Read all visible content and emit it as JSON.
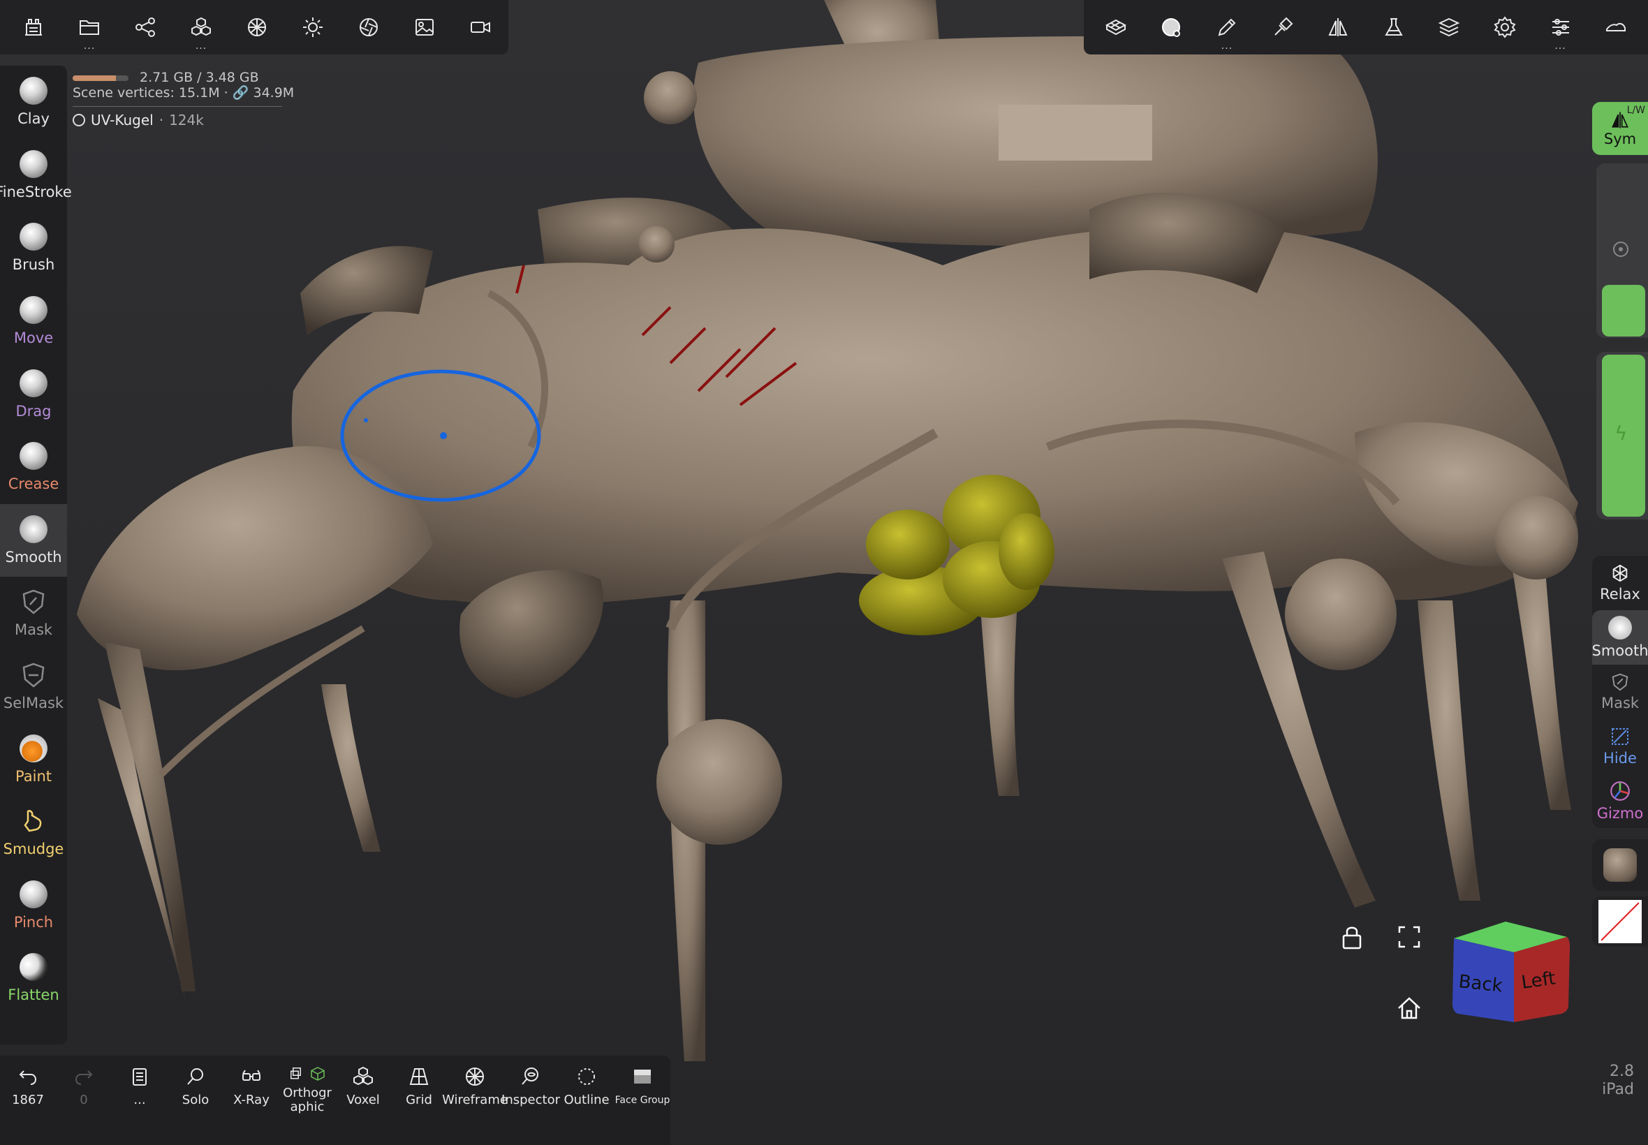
{
  "stats": {
    "memory": "2.71 GB / 3.48 GB",
    "memory_fraction": 0.78,
    "scene_vertices_label": "Scene vertices:",
    "scene_vertices_value": "15.1M",
    "linked_value": "34.9M",
    "object_name": "UV-Kugel",
    "object_count": "124k"
  },
  "top_left_tools": [
    "scene-icon",
    "open-file-icon",
    "share-icon",
    "objects-icon",
    "material-icon",
    "light-icon",
    "camera-aperture-icon",
    "image-icon",
    "video-icon"
  ],
  "top_right_tools": [
    "topology-icon",
    "active-brush-icon",
    "stroke-pen-icon",
    "brush-settings-icon",
    "symmetry-icon",
    "flask-icon",
    "layers-icon",
    "settings-gear-icon",
    "sliders-icon",
    "interface-icon"
  ],
  "left_tools": [
    {
      "label": "Clay",
      "color": "#e6e6e6"
    },
    {
      "label": "FineStroke",
      "color": "#e6e6e6"
    },
    {
      "label": "Brush",
      "color": "#e6e6e6"
    },
    {
      "label": "Move",
      "color": "#b48cd8"
    },
    {
      "label": "Drag",
      "color": "#b48cd8"
    },
    {
      "label": "Crease",
      "color": "#e98a6c"
    },
    {
      "label": "Smooth",
      "color": "#e6e6e6"
    },
    {
      "label": "Mask",
      "color": "#9a9a9a"
    },
    {
      "label": "SelMask",
      "color": "#9a9a9a"
    },
    {
      "label": "Paint",
      "color": "#f0c070"
    },
    {
      "label": "Smudge",
      "color": "#f0d070"
    },
    {
      "label": "Pinch",
      "color": "#e98a6c"
    },
    {
      "label": "Flatten",
      "color": "#8ad86a"
    }
  ],
  "right": {
    "sym_label": "Sym",
    "sym_lw": "L/W",
    "relax_label": "Relax",
    "smooth_label": "Smooth",
    "mask_label": "Mask",
    "hide_label": "Hide",
    "gizmo_label": "Gizmo",
    "radius_fraction": 0.3,
    "intensity_fraction": 1.0
  },
  "bottom": {
    "undo_count": "1867",
    "redo_count": "0",
    "more": "...",
    "solo": "Solo",
    "xray": "X-Ray",
    "ortho": "Orthographic",
    "voxel": "Voxel",
    "grid": "Grid",
    "wireframe": "Wireframe",
    "inspector": "Inspector",
    "outline": "Outline",
    "facegroup": "Face Group"
  },
  "cube": {
    "back": "Back",
    "left": "Left"
  },
  "version": {
    "number": "2.8",
    "device": "iPad"
  },
  "colors": {
    "accent_green": "#6dbf5b",
    "model_clay": "#8b7b6b",
    "yellow_mesh": "#8f8a10",
    "brush_ring": "#1565e0"
  }
}
